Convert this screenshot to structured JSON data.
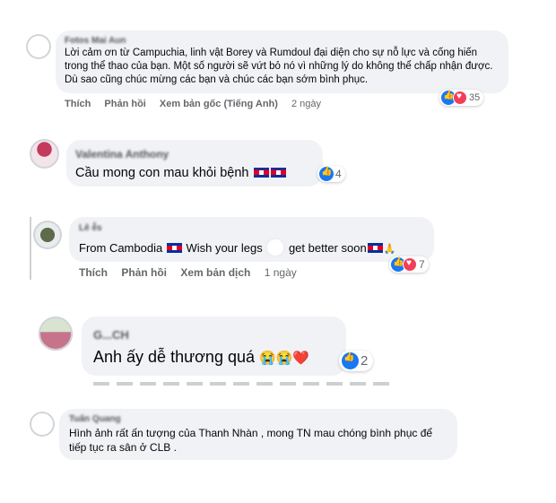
{
  "comments": [
    {
      "author": "Fotos Mai Aun",
      "text": "Lời cảm ơn từ Campuchia, linh vật Borey và Rumdoul đại diện cho sự nỗ lực và cống hiến trong thể thao của bạn. Một số người sẽ vứt bỏ nó vì những lý do không thể chấp nhận được. Dù sao cũng chúc mừng các bạn và chúc các bạn sớm bình phục.",
      "actions": {
        "like": "Thích",
        "reply": "Phản hồi",
        "translate": "Xem bản gốc (Tiếng Anh)",
        "time": "2 ngày"
      },
      "reaction_count": "35"
    },
    {
      "author": "Valentina Anthony",
      "text": "Cầu mong con mau khỏi bệnh",
      "reaction_count": "4"
    },
    {
      "author": "Lê ễs",
      "text_before": "From Cambodia",
      "text_middle": "Wish your legs",
      "text_after": "get better soon",
      "extra_emoji": "🙏",
      "actions": {
        "like": "Thích",
        "reply": "Phản hồi",
        "translate": "Xem bản dịch",
        "time": "1 ngày"
      },
      "reaction_count": "7"
    },
    {
      "author": "G...CH",
      "text": "Anh ấy dễ thương quá",
      "emojis": "😭😭❤️",
      "reaction_count": "2"
    },
    {
      "author": "Tuấn Quang",
      "text": "Hình ảnh rất ấn tượng của Thanh Nhàn , mong TN mau chóng bình phục để tiếp tục ra sân ở CLB ."
    }
  ],
  "colors": {
    "like": "#1877f2",
    "love": "#f33e58",
    "bubble": "#f0f2f5",
    "meta": "#65676b"
  }
}
